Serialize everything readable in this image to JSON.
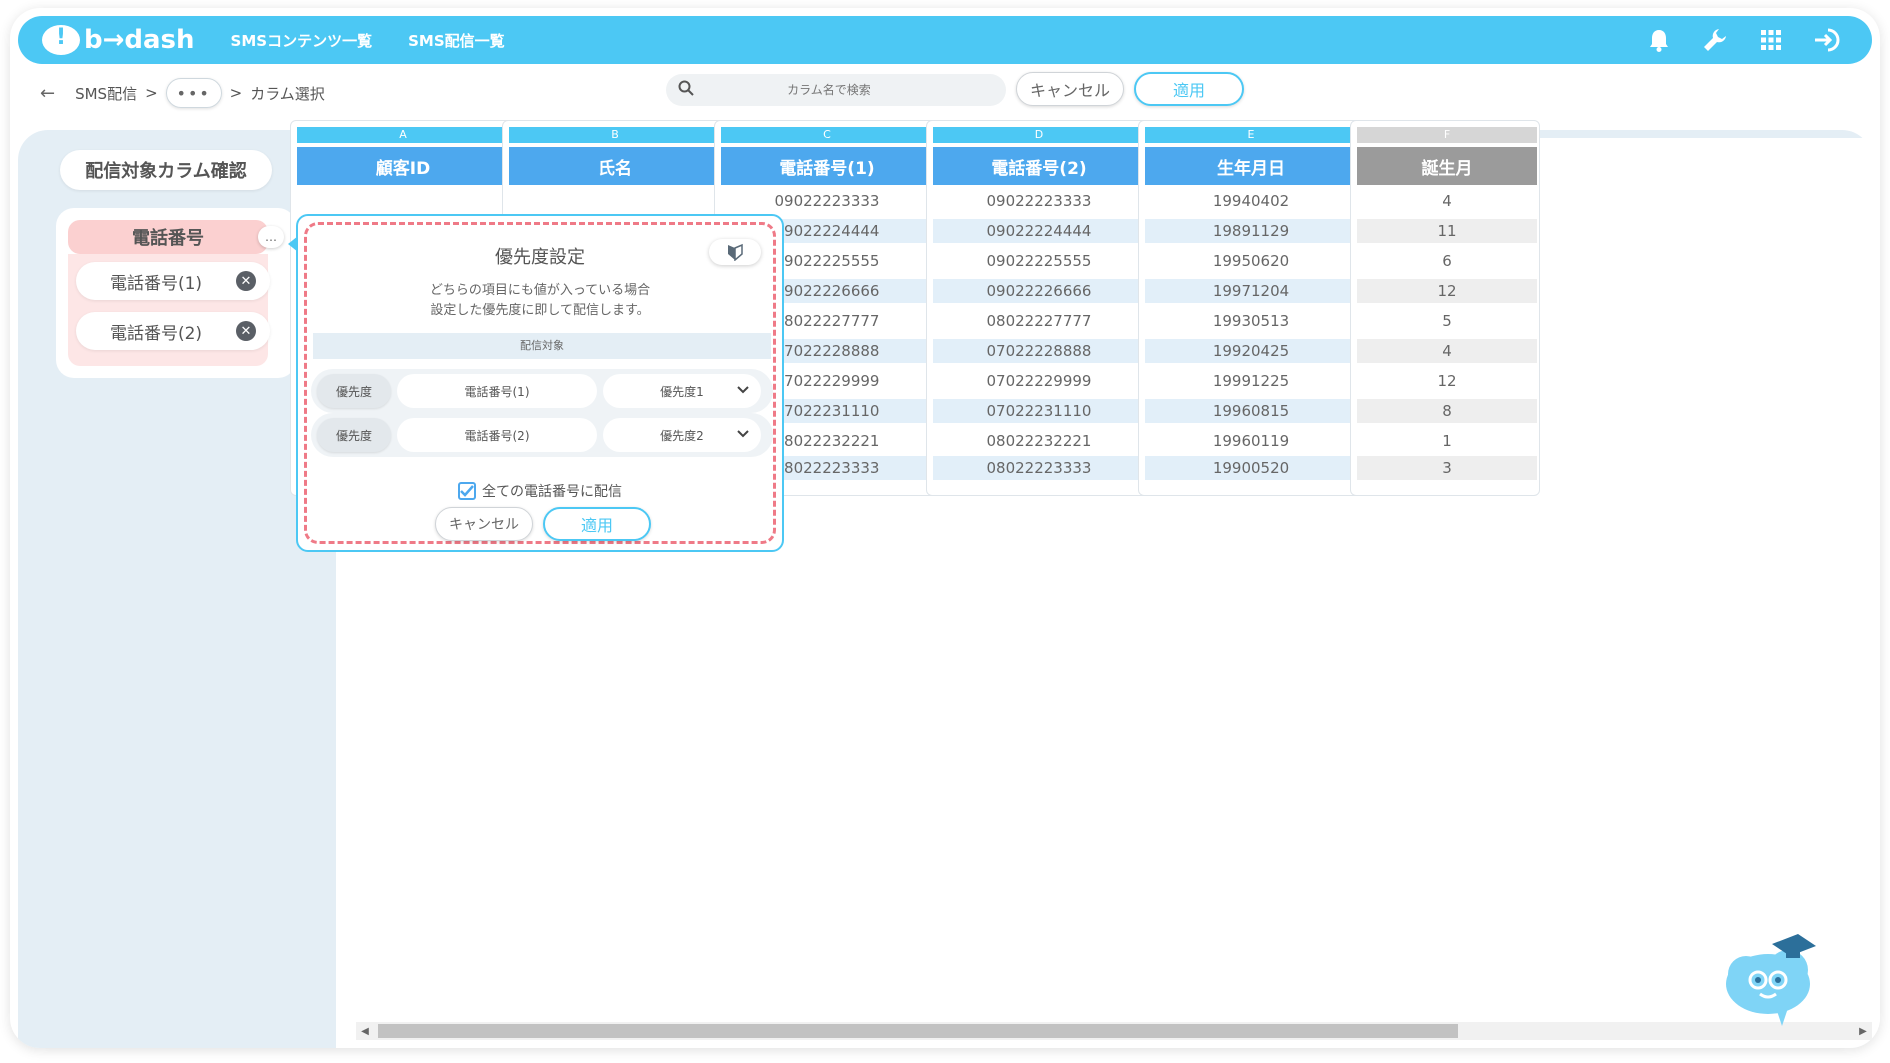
{
  "header": {
    "logo": "b→dash",
    "nav": [
      "SMSコンテンツ一覧",
      "SMS配信一覧"
    ],
    "icons": [
      "bell-icon",
      "wrench-icon",
      "grid-icon",
      "logout-icon"
    ]
  },
  "breadcrumb": {
    "back": "←",
    "root": "SMS配信",
    "sep": ">",
    "more": "•••",
    "current": "カラム選択"
  },
  "search": {
    "placeholder": "カラム名で検索"
  },
  "toolbar": {
    "cancel": "キャンセル",
    "apply": "適用"
  },
  "sidebar": {
    "title": "配信対象カラム確認",
    "group": {
      "name": "電話番号",
      "menu": "…",
      "columns": [
        "電話番号(1)",
        "電話番号(2)"
      ]
    }
  },
  "columns": [
    {
      "letter": "A",
      "name": "顧客ID",
      "cells": []
    },
    {
      "letter": "B",
      "name": "氏名",
      "cells": []
    },
    {
      "letter": "C",
      "name": "電話番号(1)",
      "cells": [
        "09022223333",
        "09022224444",
        "09022225555",
        "09022226666",
        "08022227777",
        "07022228888",
        "07022229999",
        "07022231110",
        "08022232221",
        "08022223333"
      ]
    },
    {
      "letter": "D",
      "name": "電話番号(2)",
      "cells": [
        "09022223333",
        "09022224444",
        "09022225555",
        "09022226666",
        "08022227777",
        "07022228888",
        "07022229999",
        "07022231110",
        "08022232221",
        "08022223333"
      ]
    },
    {
      "letter": "E",
      "name": "生年月日",
      "cells": [
        "19940402",
        "19891129",
        "19950620",
        "19971204",
        "19930513",
        "19920425",
        "19991225",
        "19960815",
        "19960119",
        "19900520"
      ]
    },
    {
      "letter": "F",
      "name": "誕生月",
      "cells": [
        "4",
        "11",
        "6",
        "12",
        "5",
        "4",
        "12",
        "8",
        "1",
        "3"
      ]
    }
  ],
  "popup": {
    "title": "優先度設定",
    "description_line1": "どちらの項目にも値が入っている場合",
    "description_line2": "設定した優先度に即して配信します。",
    "section_label": "配信対象",
    "rows": [
      {
        "label": "優先度",
        "field": "電話番号(1)",
        "priority": "優先度1"
      },
      {
        "label": "優先度",
        "field": "電話番号(2)",
        "priority": "優先度2"
      }
    ],
    "checkbox_label": "全ての電話番号に配信",
    "checkbox_checked": true,
    "cancel": "キャンセル",
    "apply": "適用"
  },
  "colors": {
    "brand": "#4cc8f4",
    "header_blue": "#4da8ee",
    "highlight_pink": "#fbd0d0",
    "dashed_red": "#ef7a87"
  }
}
